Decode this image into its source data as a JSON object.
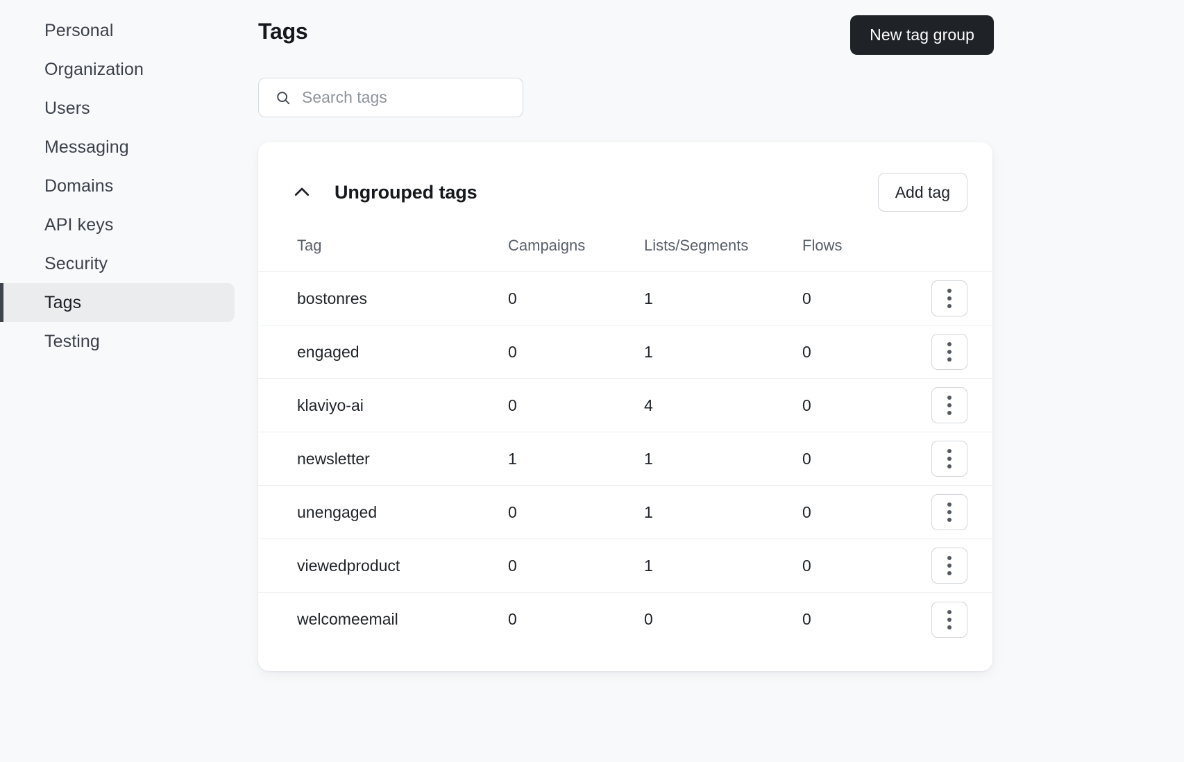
{
  "sidebar": {
    "items": [
      {
        "label": "Personal",
        "active": false
      },
      {
        "label": "Organization",
        "active": false
      },
      {
        "label": "Users",
        "active": false
      },
      {
        "label": "Messaging",
        "active": false
      },
      {
        "label": "Domains",
        "active": false
      },
      {
        "label": "API keys",
        "active": false
      },
      {
        "label": "Security",
        "active": false
      },
      {
        "label": "Tags",
        "active": true
      },
      {
        "label": "Testing",
        "active": false
      }
    ]
  },
  "header": {
    "title": "Tags",
    "new_tag_group_label": "New tag group"
  },
  "search": {
    "placeholder": "Search tags",
    "value": "",
    "icon": "search-icon"
  },
  "group": {
    "collapse_icon": "chevron-up-icon",
    "title": "Ungrouped tags",
    "add_tag_label": "Add tag",
    "expanded": true
  },
  "table": {
    "columns": [
      "Tag",
      "Campaigns",
      "Lists/Segments",
      "Flows"
    ],
    "row_menu_icon": "kebab-menu-icon",
    "rows": [
      {
        "tag": "bostonres",
        "campaigns": "0",
        "lists_segments": "1",
        "flows": "0"
      },
      {
        "tag": "engaged",
        "campaigns": "0",
        "lists_segments": "1",
        "flows": "0"
      },
      {
        "tag": "klaviyo-ai",
        "campaigns": "0",
        "lists_segments": "4",
        "flows": "0"
      },
      {
        "tag": "newsletter",
        "campaigns": "1",
        "lists_segments": "1",
        "flows": "0"
      },
      {
        "tag": "unengaged",
        "campaigns": "0",
        "lists_segments": "1",
        "flows": "0"
      },
      {
        "tag": "viewedproduct",
        "campaigns": "0",
        "lists_segments": "1",
        "flows": "0"
      },
      {
        "tag": "welcomeemail",
        "campaigns": "0",
        "lists_segments": "0",
        "flows": "0"
      }
    ]
  },
  "colors": {
    "page_bg": "#f8f9fb",
    "card_bg": "#ffffff",
    "primary_button_bg": "#1f2328",
    "active_nav_bg": "#ebecee",
    "active_nav_accent": "#3f444b",
    "text": "#1f2328",
    "muted_text": "#595f68"
  }
}
